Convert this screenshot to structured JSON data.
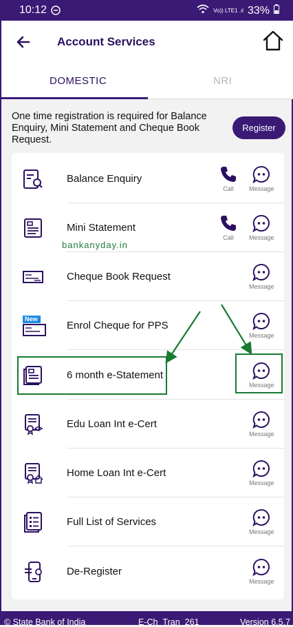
{
  "status_bar": {
    "time": "10:12",
    "signal": "Vo)) LTE1 .ıl",
    "battery": "33%"
  },
  "app_bar": {
    "title": "Account Services"
  },
  "tabs": [
    {
      "label": "DOMESTIC",
      "active": true
    },
    {
      "label": "NRI",
      "active": false
    }
  ],
  "notice": {
    "text": "One time registration is required for Balance Enquiry, Mini Statement and Cheque Book Request.",
    "button": "Register"
  },
  "services": [
    {
      "label": "Balance Enquiry",
      "icon": "balance-enquiry-icon",
      "call": "Call",
      "message": "Message"
    },
    {
      "label": "Mini Statement",
      "icon": "mini-statement-icon",
      "call": "Call",
      "message": "Message"
    },
    {
      "label": "Cheque Book Request",
      "icon": "cheque-book-icon",
      "message": "Message"
    },
    {
      "label": "Enrol Cheque for PPS",
      "icon": "enrol-cheque-icon",
      "badge": "New",
      "message": "Message"
    },
    {
      "label": "6 month e-Statement",
      "icon": "e-statement-icon",
      "message": "Message"
    },
    {
      "label": "Edu Loan Int e-Cert",
      "icon": "edu-loan-icon",
      "message": "Message"
    },
    {
      "label": "Home Loan Int e-Cert",
      "icon": "home-loan-icon",
      "message": "Message"
    },
    {
      "label": "Full List of Services",
      "icon": "full-list-icon",
      "message": "Message"
    },
    {
      "label": "De-Register",
      "icon": "de-register-icon",
      "message": "Message"
    }
  ],
  "watermark": "bankanyday.in",
  "footer": {
    "left": "© State Bank of India",
    "middle": "E-Ch_Tran_261",
    "right": "Version 6.5.7"
  },
  "colors": {
    "primary": "#3b1a75",
    "highlight": "#167a32"
  }
}
